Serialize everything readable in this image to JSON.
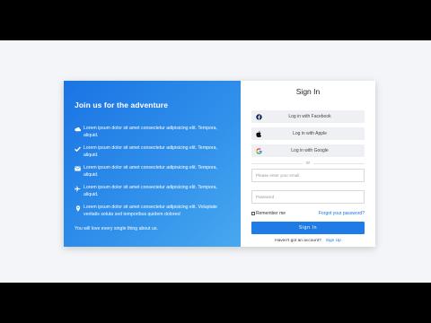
{
  "left_panel": {
    "title": "Join us for the adventure",
    "features": [
      {
        "icon": "cloud-icon",
        "text": "Lorem ipsum dolor sit amet consectetur adipisicing elit. Tempora, aliquid."
      },
      {
        "icon": "check-icon",
        "text": "Lorem ipsum dolor sit amet consectetur adipisicing elit. Tempora, aliquid."
      },
      {
        "icon": "envelope-icon",
        "text": "Lorem ipsum dolor sit amet consectetur adipisicing elit. Tempora, aliquid."
      },
      {
        "icon": "plane-icon",
        "text": "Lorem ipsum dolor sit amet consectetur adipisicing elit. Tempora, aliquid."
      },
      {
        "icon": "location-pin-icon",
        "text": "Lorem ipsum dolor sit amet consectetur adipisicing elit. Voluptate veritatis soluta sed temporibus quidem dolores!"
      }
    ],
    "footer": "You will love every single thing about us."
  },
  "right_panel": {
    "title": "Sign In",
    "social": [
      {
        "icon": "facebook-icon",
        "label": "Log in with Facebook"
      },
      {
        "icon": "apple-icon",
        "label": "Log in with Apple"
      },
      {
        "icon": "google-icon",
        "label": "Log in with Google"
      }
    ],
    "divider": "or",
    "email_placeholder": "Please enter your email",
    "password_placeholder": "Password",
    "remember_label": "Remember me",
    "forgot_label": "Forgot your password?",
    "signin_label": "Sign In",
    "signup_prompt": "Haven't got an account?",
    "signup_link": "Sign Up"
  },
  "colors": {
    "accent": "#1f7be6",
    "gradient_start": "#1b74e4",
    "gradient_end": "#48a8f0"
  }
}
